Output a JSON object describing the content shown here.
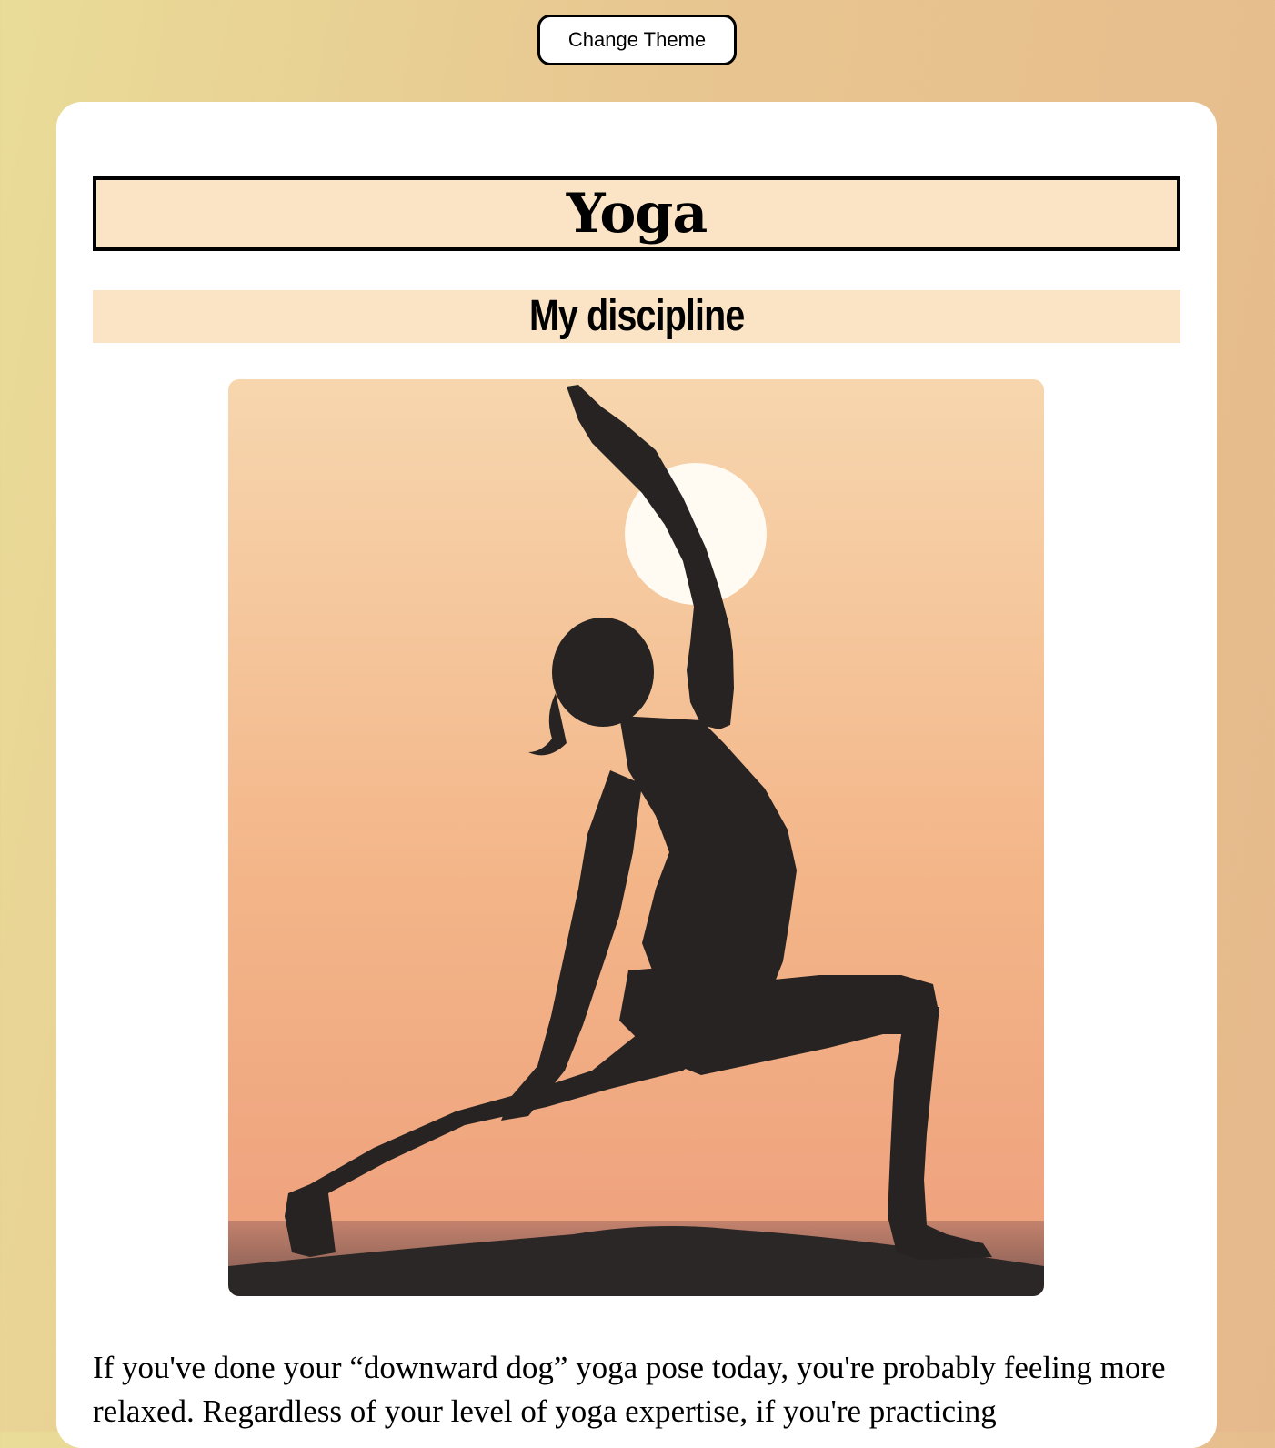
{
  "header": {
    "change_theme_label": "Change Theme"
  },
  "article": {
    "title": "Yoga",
    "subtitle": "My discipline",
    "paragraph": "If you've done your “downward dog” yoga pose today, you're probably feeling more relaxed. Regardless of your level of yoga expertise, if you're practicing"
  },
  "colors": {
    "title_background": "#fbe4c6",
    "sky_top": "#f7d6ae",
    "sky_bottom": "#f0a680",
    "silhouette": "#262322"
  }
}
